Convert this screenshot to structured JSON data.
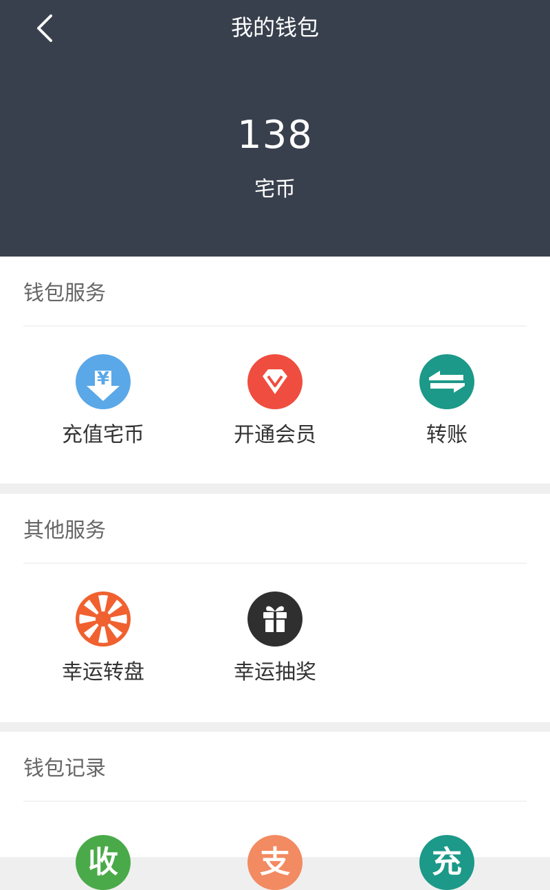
{
  "header": {
    "title": "我的钱包",
    "balance": "138",
    "unit": "宅币"
  },
  "wallet_services": {
    "title": "钱包服务",
    "items": [
      {
        "label": "充值宅币",
        "icon": "recharge-yen-icon",
        "color": "#5aa8e8"
      },
      {
        "label": "开通会员",
        "icon": "diamond-icon",
        "color": "#ef4d3f"
      },
      {
        "label": "转账",
        "icon": "transfer-arrows-icon",
        "color": "#1c9988"
      }
    ]
  },
  "other_services": {
    "title": "其他服务",
    "items": [
      {
        "label": "幸运转盘",
        "icon": "wheel-icon",
        "color": "#f0612f"
      },
      {
        "label": "幸运抽奖",
        "icon": "gift-icon",
        "color": "#2f2f2f"
      }
    ]
  },
  "wallet_records": {
    "title": "钱包记录",
    "items": [
      {
        "icon": "income-icon",
        "color": "#4aaa49",
        "char": "收"
      },
      {
        "icon": "expense-icon",
        "color": "#f28a62",
        "char": "支"
      },
      {
        "icon": "recharge-record-icon",
        "color": "#1c9988",
        "char": "充"
      }
    ]
  },
  "colors": {
    "header_bg": "#39404d",
    "page_bg": "#efefef"
  }
}
